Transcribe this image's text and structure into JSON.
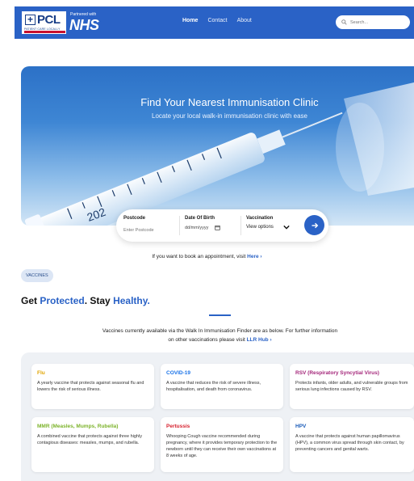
{
  "nav": {
    "logo_text": "PCL",
    "logo_sub": "PATIENT CARE LOCALLY",
    "partner_label": "Partnered with",
    "nhs_label": "NHS",
    "links": [
      {
        "label": "Home",
        "active": true
      },
      {
        "label": "Contact",
        "active": false
      },
      {
        "label": "About",
        "active": false
      }
    ],
    "search_placeholder": "Search..."
  },
  "hero": {
    "title": "Find Your Nearest Immunisation Clinic",
    "subtitle": "Locate your local walk-in immunisation clinic with ease",
    "syringe_scale": "202"
  },
  "finder": {
    "postcode_label": "Postcode",
    "postcode_placeholder": "Enter Postcode",
    "dob_label": "Date Of Birth",
    "dob_value": "dd/mm/yyyy",
    "vaccination_label": "Vaccination",
    "vaccination_value": "View options"
  },
  "book": {
    "text": "If you want to book an appointment, visit",
    "link": "Here ›"
  },
  "tag": "VACCINES",
  "heading": {
    "part1": "Get ",
    "part2": "Protected",
    "part3": ". Stay ",
    "part4": "Healthy."
  },
  "intro": {
    "text": "Vaccines currently available via the Walk In Immunisation Finder are as below. For further information on other vaccinations please visit",
    "link": "LLR Hub ›"
  },
  "colors": {
    "primary": "#2a62c6",
    "flu": "#e0a400",
    "covid": "#1a73e8",
    "rsv": "#a4267a",
    "mmr": "#7cb32a",
    "pertussis": "#d61f2c",
    "hpv": "#1a5bb8"
  },
  "vaccines": [
    {
      "title": "Flu",
      "desc": "A yearly vaccine that protects against seasonal flu and lowers the risk of serious illness."
    },
    {
      "title": "COVID-19",
      "desc": "A vaccine that reduces the risk of severe illness, hospitalisation, and death from coronavirus."
    },
    {
      "title": "RSV (Respiratory Syncytial Virus)",
      "desc": "Protects infants, older adults, and vulnerable groups from serious lung infections caused by RSV."
    },
    {
      "title": "MMR (Measles, Mumps, Rubella)",
      "desc": "A combined vaccine that protects against three highly contagious diseases: measles, mumps, and rubella."
    },
    {
      "title": "Pertussis",
      "desc": "Whooping Cough vaccine recommended during pregnancy, where it provides temporary protection to the newborn until they can receive their own vaccinations at 8 weeks of age."
    },
    {
      "title": "HPV",
      "desc": "A vaccine that protects against human papillomavirus (HPV), a common virus spread through skin contact, by preventing cancers and genital warts."
    }
  ]
}
